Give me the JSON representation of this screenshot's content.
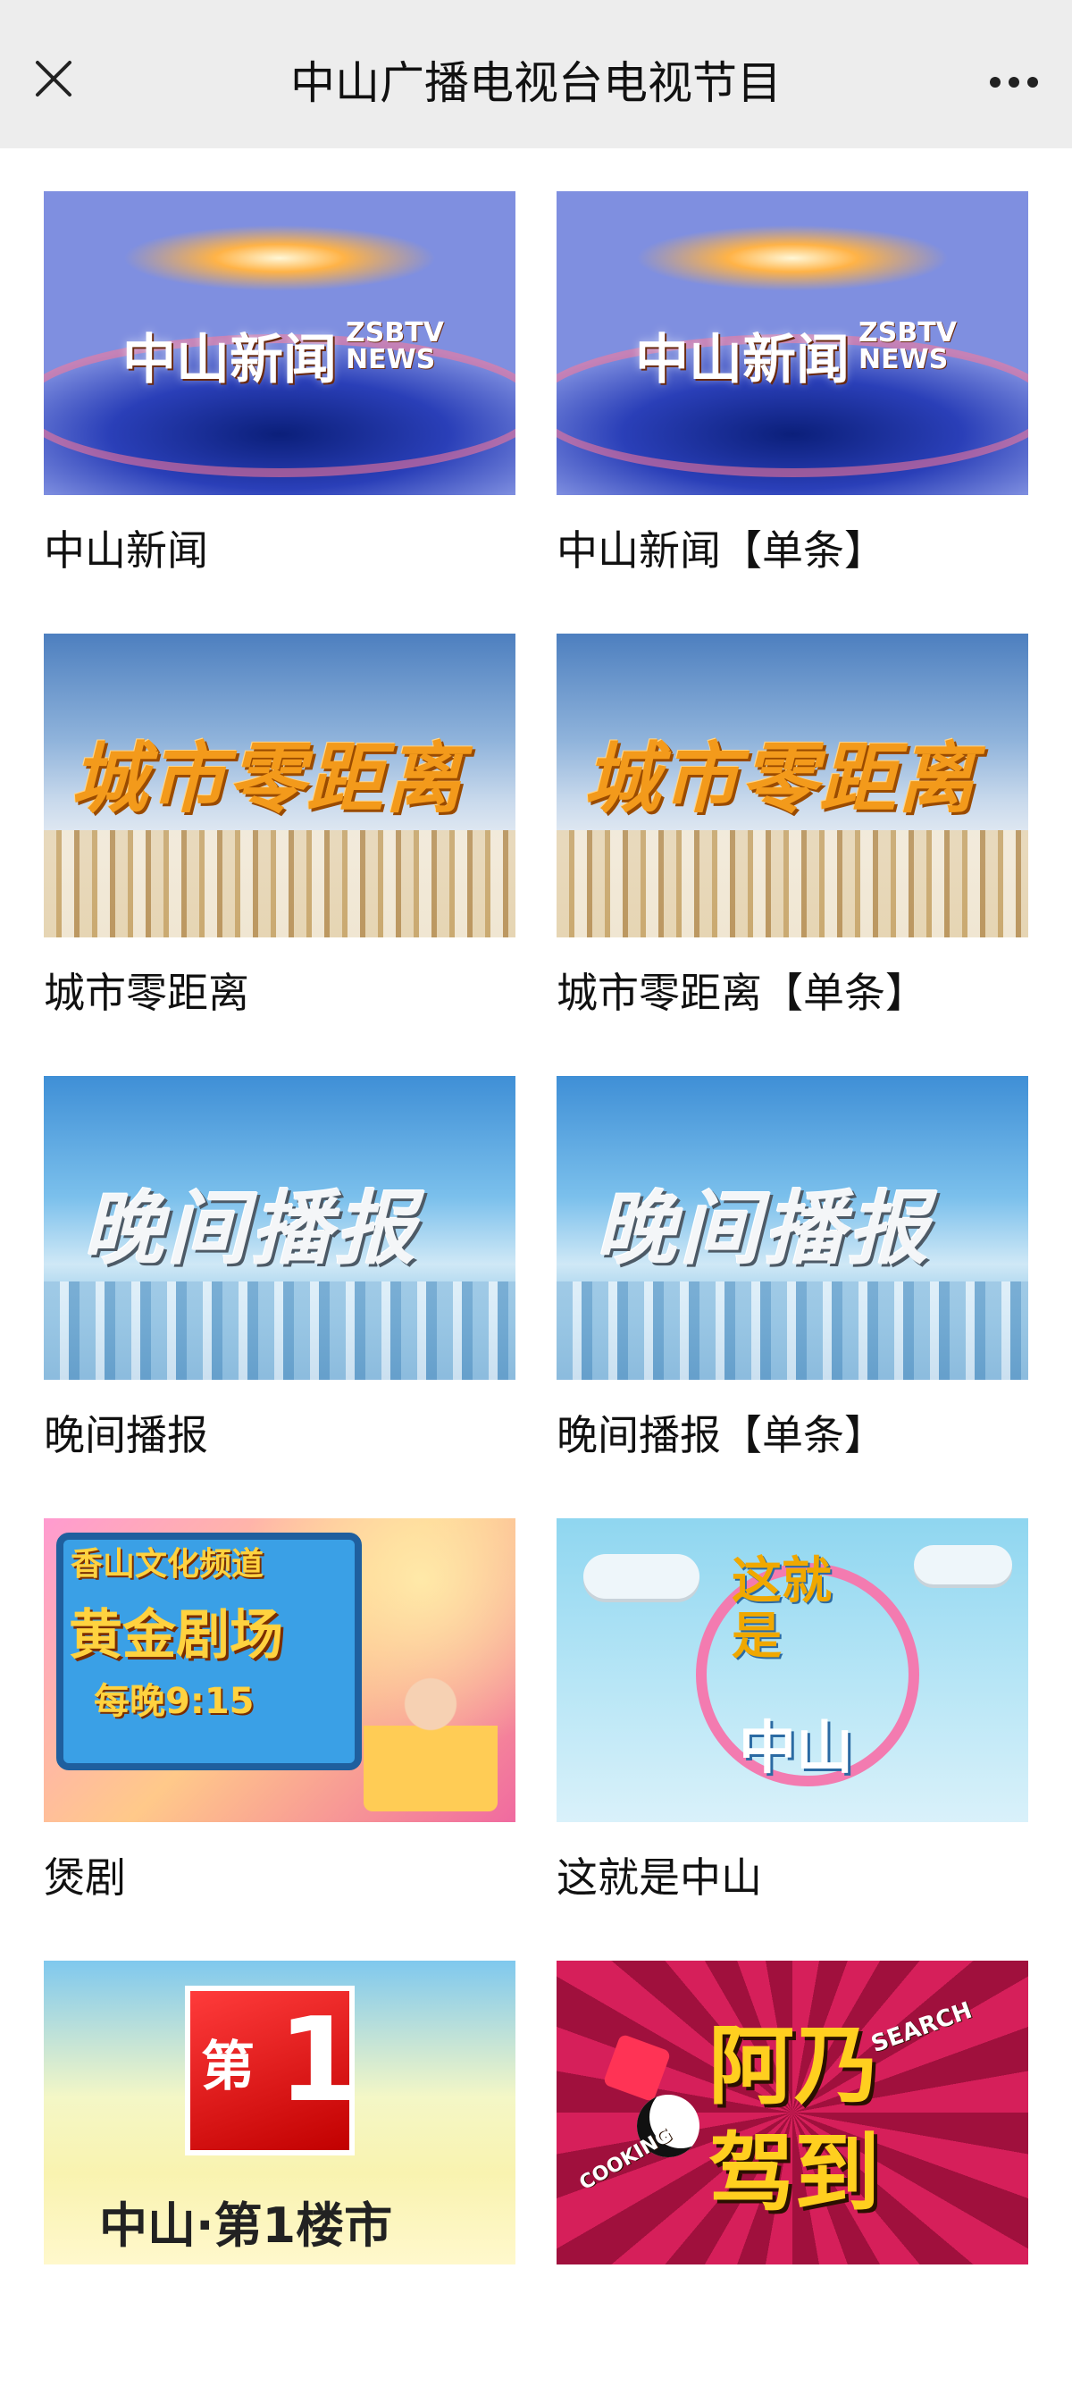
{
  "header": {
    "title": "中山广播电视台电视节目",
    "close_icon": "close-icon",
    "more_icon": "more-horizontal-icon",
    "background_color": "#ededed"
  },
  "programs": [
    {
      "label": "中山新闻",
      "thumb": "news",
      "thumb_text": [
        "中山新闻",
        "ZSBTV NEWS"
      ]
    },
    {
      "label": "中山新闻【单条】",
      "thumb": "news",
      "thumb_text": [
        "中山新闻",
        "ZSBTV NEWS"
      ]
    },
    {
      "label": "城市零距离",
      "thumb": "city",
      "thumb_text": [
        "城市零距离"
      ]
    },
    {
      "label": "城市零距离【单条】",
      "thumb": "city",
      "thumb_text": [
        "城市零距离"
      ]
    },
    {
      "label": "晚间播报",
      "thumb": "evening",
      "thumb_text": [
        "晚间播报"
      ]
    },
    {
      "label": "晚间播报【单条】",
      "thumb": "evening",
      "thumb_text": [
        "晚间播报"
      ]
    },
    {
      "label": "煲剧",
      "thumb": "drama",
      "thumb_text": [
        "香山文化频道",
        "黄金剧场",
        "每晚9:15"
      ]
    },
    {
      "label": "这就是中山",
      "thumb": "zhongshan",
      "thumb_text": [
        "这就是",
        "中山"
      ]
    },
    {
      "label": "",
      "thumb": "property",
      "thumb_text": [
        "第",
        "1",
        "中山·第1楼市"
      ]
    },
    {
      "label": "",
      "thumb": "anai",
      "thumb_text": [
        "阿乃",
        "驾到",
        "SEARCH",
        "COOKING"
      ]
    }
  ]
}
